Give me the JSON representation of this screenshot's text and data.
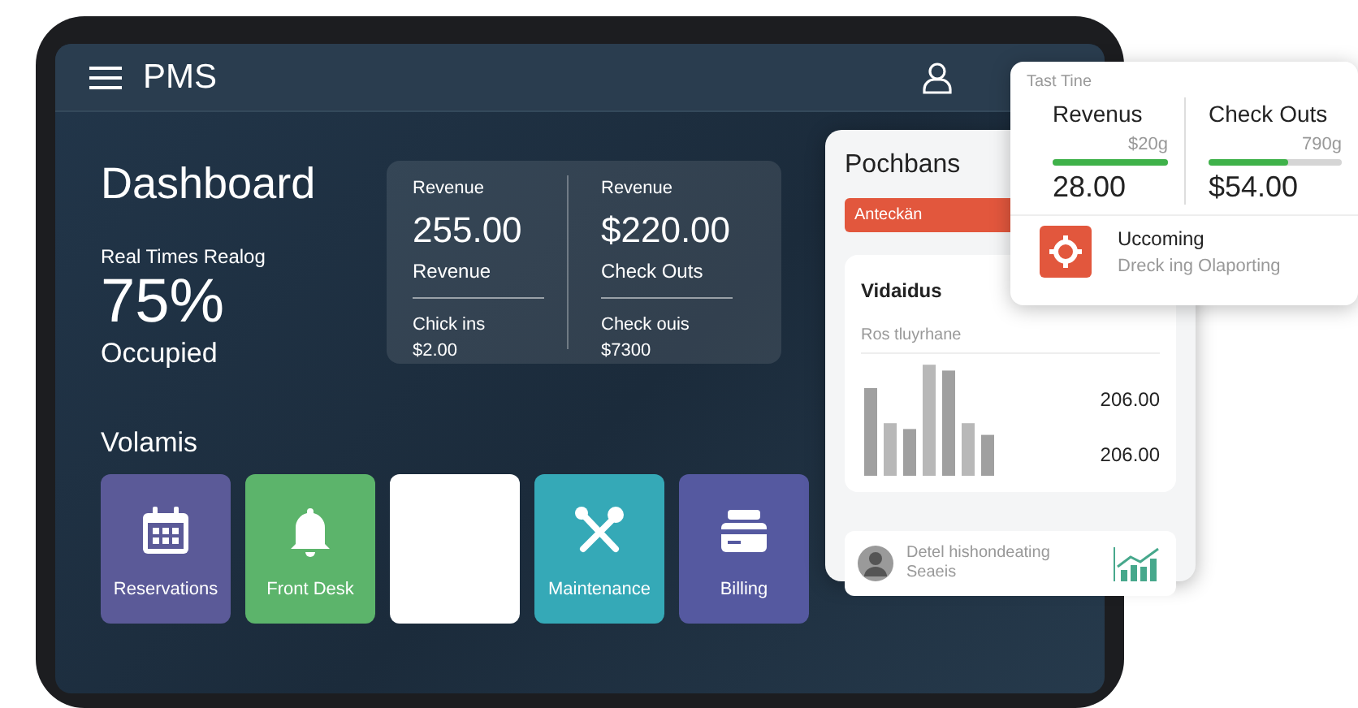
{
  "app": {
    "title": "PMS"
  },
  "summary": {
    "title": "Dashboard",
    "subtitle": "Real Times Realog",
    "value": "75%",
    "value_label": "Occupied"
  },
  "stats": [
    {
      "label": "Revenue",
      "value": "255.00",
      "caption": "Revenue",
      "sub_label": "Chick ins",
      "sub_value": "$2.00"
    },
    {
      "label": "Revenue",
      "value": "$220.00",
      "caption": "Check Outs",
      "sub_label": "Check ouis",
      "sub_value": "$7300"
    }
  ],
  "section_title": "Volamis",
  "tiles": [
    {
      "kind": "calendar",
      "label": "Reservations",
      "color": "#5b5a98"
    },
    {
      "kind": "bell",
      "label": "Front Desk",
      "color": "#5cb46b"
    },
    {
      "kind": "blank",
      "color": "#ffffff"
    },
    {
      "kind": "tools",
      "label": "Maintenance",
      "color": "#35a9b7"
    },
    {
      "kind": "card",
      "label": "Billing",
      "color": "#5559a0"
    }
  ],
  "panel": {
    "title": "Pochbans",
    "badge": "Anteckän",
    "card_title": "Vidaidus",
    "card_subtitle": "Ros tluyrhane",
    "values": [
      "206.00",
      "206.00"
    ],
    "footer_lines": [
      "Detel hishondeating",
      "Seaeis"
    ]
  },
  "popup": {
    "title": "Tast Tine",
    "metrics": [
      {
        "name": "Revenus",
        "reading": "$20g",
        "level": 1,
        "value": "28.00"
      },
      {
        "name": "Check Outs",
        "reading": "790g",
        "level": 0.6,
        "value": "$54.00"
      }
    ],
    "notice": {
      "title": "Uccoming",
      "text": "Dreck ing Olaporting"
    }
  }
}
